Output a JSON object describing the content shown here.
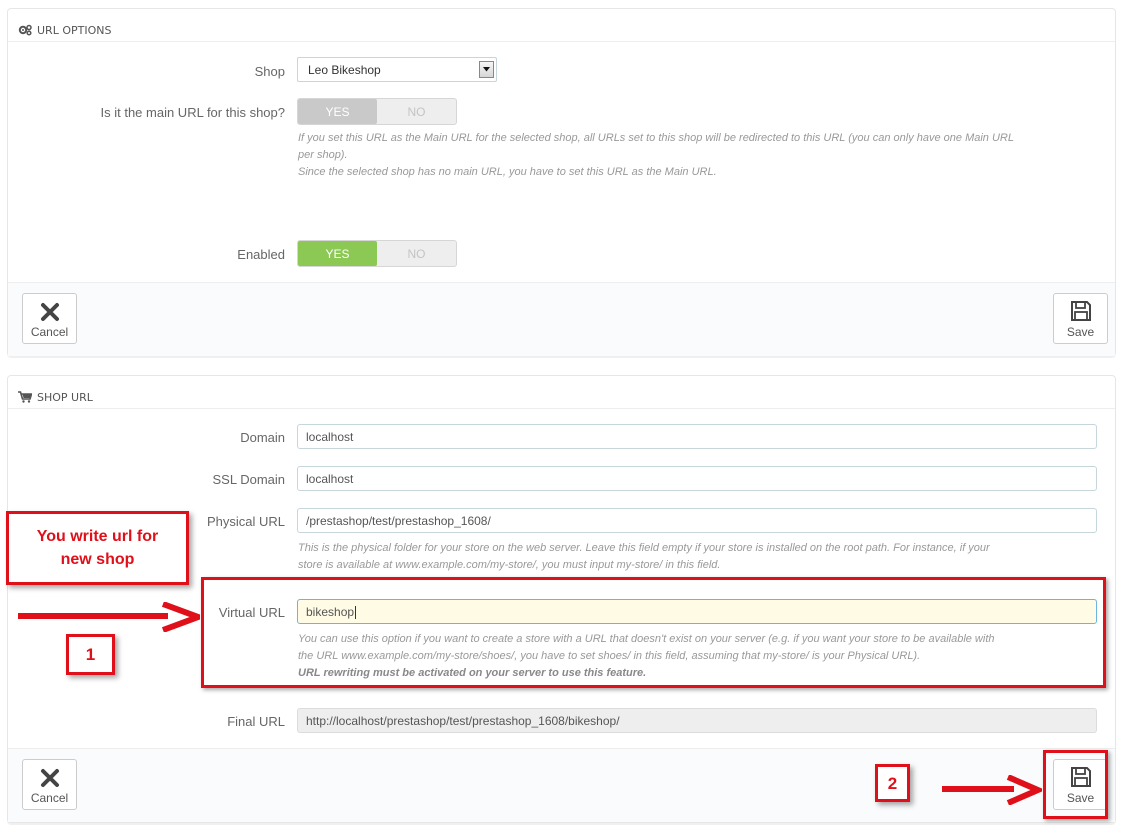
{
  "url_options": {
    "heading": "URL OPTIONS",
    "shop_label": "Shop",
    "shop_value": "Leo Bikeshop",
    "main_url_label": "Is it the main URL for this shop?",
    "main_url_yes": "YES",
    "main_url_no": "NO",
    "main_url_help_1": "If you set this URL as the Main URL for the selected shop, all URLs set to this shop will be redirected to this URL (you can only have one Main URL",
    "main_url_help_2": "per shop).",
    "main_url_help_3": "Since the selected shop has no main URL, you have to set this URL as the Main URL.",
    "enabled_label": "Enabled",
    "enabled_yes": "YES",
    "enabled_no": "NO",
    "cancel_label": "Cancel",
    "save_label": "Save"
  },
  "shop_url": {
    "heading": "SHOP URL",
    "domain_label": "Domain",
    "domain_value": "localhost",
    "ssl_domain_label": "SSL Domain",
    "ssl_domain_value": "localhost",
    "physical_url_label": "Physical URL",
    "physical_url_value": "/prestashop/test/prestashop_1608/",
    "physical_help_1": "This is the physical folder for your store on the web server. Leave this field empty if your store is installed on the root path. For instance, if your",
    "physical_help_2": "store is available at www.example.com/my-store/, you must input my-store/ in this field.",
    "virtual_url_label": "Virtual URL",
    "virtual_url_value": "bikeshop",
    "virtual_help_1": "You can use this option if you want to create a store with a URL that doesn't exist on your server (e.g. if you want your store to be available with",
    "virtual_help_2": "the URL www.example.com/my-store/shoes/, you have to set shoes/ in this field, assuming that my-store/ is your Physical URL).",
    "virtual_help_3": "URL rewriting must be activated on your server to use this feature.",
    "final_url_label": "Final URL",
    "final_url_value": "http://localhost/prestashop/test/prestashop_1608/bikeshop/",
    "cancel_label": "Cancel",
    "save_label": "Save"
  },
  "annotations": {
    "callout_text_1": "You write url for",
    "callout_text_2": "new shop",
    "step_1": "1",
    "step_2": "2",
    "accent_color": "#e0101a"
  },
  "colors": {
    "toggle_on": "#8bc954",
    "toggle_default": "#c9c9c9",
    "focused_input_bg": "#fffbe4"
  }
}
